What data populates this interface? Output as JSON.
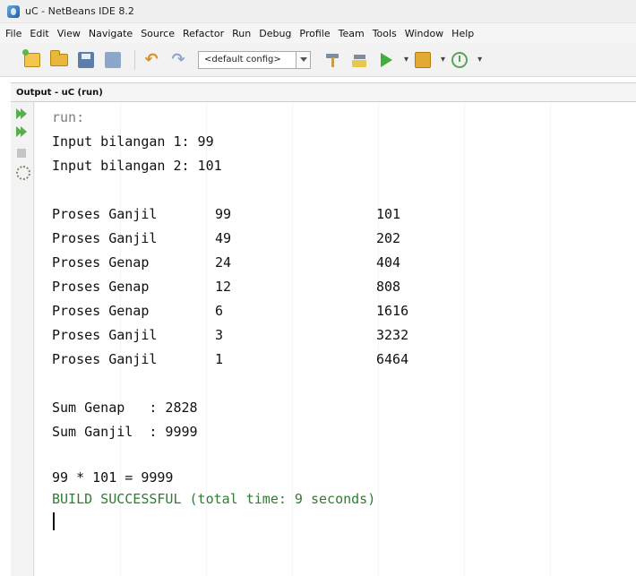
{
  "window": {
    "title": "uC - NetBeans IDE 8.2"
  },
  "menu": [
    "File",
    "Edit",
    "View",
    "Navigate",
    "Source",
    "Refactor",
    "Run",
    "Debug",
    "Profile",
    "Team",
    "Tools",
    "Window",
    "Help"
  ],
  "toolbar": {
    "config_value": "<default config>"
  },
  "output": {
    "tab_label": "Output - uC (run)",
    "header": "run:",
    "input1": "Input bilangan 1: 99",
    "input2": "Input bilangan 2: 101",
    "rows": [
      {
        "label": "Proses Ganjil",
        "a": "99",
        "b": "101"
      },
      {
        "label": "Proses Ganjil",
        "a": "49",
        "b": "202"
      },
      {
        "label": "Proses Genap",
        "a": "24",
        "b": "404"
      },
      {
        "label": "Proses Genap",
        "a": "12",
        "b": "808"
      },
      {
        "label": "Proses Genap",
        "a": "6",
        "b": "1616"
      },
      {
        "label": "Proses Ganjil",
        "a": "3",
        "b": "3232"
      },
      {
        "label": "Proses Ganjil",
        "a": "1",
        "b": "6464"
      }
    ],
    "sum_genap": "Sum Genap   : 2828",
    "sum_ganjil": "Sum Ganjil  : 9999",
    "result": "99 * 101 = 9999",
    "build_status": "BUILD SUCCESSFUL (total time: 9 seconds)"
  },
  "colors": {
    "build_success": "#2e7d32",
    "run_icon": "#3fae3c"
  },
  "icons": [
    "new-project-icon",
    "open-project-icon",
    "save-all-icon",
    "undo-icon",
    "redo-icon",
    "build-icon",
    "clean-build-icon",
    "run-icon",
    "debug-icon",
    "profile-icon",
    "rerun-icon",
    "stop-icon",
    "settings-icon"
  ]
}
